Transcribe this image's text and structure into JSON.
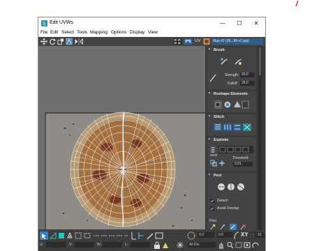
{
  "window": {
    "title": "Edit UVWs",
    "minimize": "—",
    "maximize": "☐",
    "close": "✕"
  },
  "menu": [
    "File",
    "Edit",
    "Select",
    "Tools",
    "Mapping",
    "Options",
    "Display",
    "View"
  ],
  "toolbar": {
    "uv_label": "UV",
    "map_dropdown": "Map #2 (09...88-v2.jpg)"
  },
  "panel": {
    "brush": {
      "title": "Brush",
      "strength_label": "Strength:",
      "strength_value": "20.0",
      "falloff_label": "Falloff:",
      "falloff_value": "20.0"
    },
    "reshape": {
      "title": "Reshape Elements"
    },
    "stitch": {
      "title": "Stitch"
    },
    "explode": {
      "title": "Explode",
      "weld_label": "Weld",
      "threshold_label": "Threshold:",
      "threshold_value": "0.01"
    },
    "peel": {
      "title": "Peel",
      "detach_label": "Detach",
      "avoid_overlap_label": "Avoid Overlap",
      "pins_label": "Pins:"
    }
  },
  "bottom": {
    "u_label": "U:",
    "v_label": "V:",
    "w_label": "W:",
    "l_label": "L:",
    "spin_value_1": "0.0",
    "spin_value_2": "0.0",
    "xy_label": "XY",
    "zoom_value": "16",
    "ids_dropdown": "All IDs"
  },
  "colors": {
    "accent": "#3a7fc1",
    "viewport_bg": "#6f6f6f",
    "panel_bg": "#3a3a3a"
  }
}
